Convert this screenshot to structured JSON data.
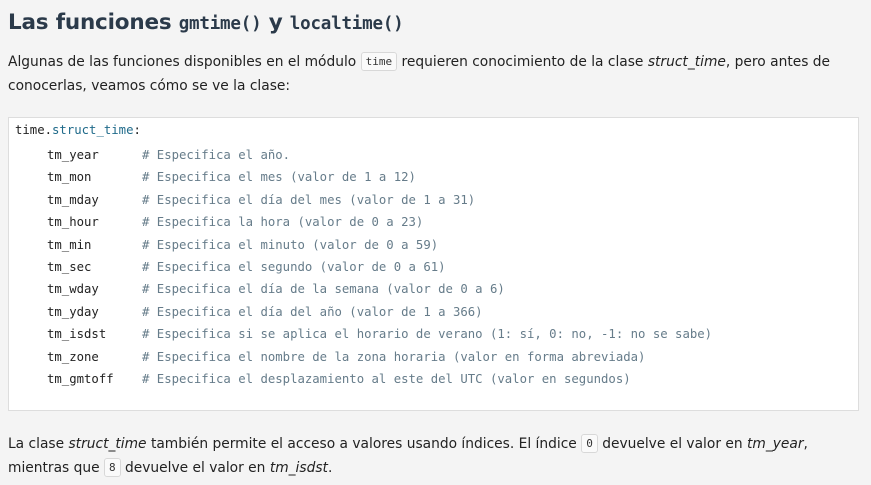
{
  "heading": {
    "prefix": "Las funciones ",
    "func1": "gmtime()",
    "conj": " y ",
    "func2": "localtime()"
  },
  "intro": {
    "text1": "Algunas de las funciones disponibles en el módulo ",
    "code": "time",
    "text2": " requieren conocimiento de la clase ",
    "em": "struct_time",
    "text3": ", pero antes de conocerlas, veamos cómo se ve la clase:"
  },
  "code": {
    "head_obj": "time.",
    "head_attr": "struct_time",
    "head_colon": ":",
    "rows": [
      {
        "field": "tm_year",
        "comment": "# Especifica el año."
      },
      {
        "field": "tm_mon",
        "comment": "# Especifica el mes (valor de 1 a 12)"
      },
      {
        "field": "tm_mday",
        "comment": "# Especifica el día del mes (valor de 1 a 31)"
      },
      {
        "field": "tm_hour",
        "comment": "# Especifica la hora (valor de 0 a 23)"
      },
      {
        "field": "tm_min",
        "comment": "# Especifica el minuto (valor de 0 a 59)"
      },
      {
        "field": "tm_sec",
        "comment": "# Especifica el segundo (valor de 0 a 61)"
      },
      {
        "field": "tm_wday",
        "comment": "# Especifica el día de la semana (valor de 0 a 6)"
      },
      {
        "field": "tm_yday",
        "comment": "# Especifica el día del año (valor de 1 a 366)"
      },
      {
        "field": "tm_isdst",
        "comment": "# Especifica si se aplica el horario de verano (1: sí, 0: no, -1: no se sabe)"
      },
      {
        "field": "tm_zone",
        "comment": "# Especifica el nombre de la zona horaria (valor en forma abreviada)"
      },
      {
        "field": "tm_gmtoff",
        "comment": "# Especifica el desplazamiento al este del UTC (valor en segundos)"
      }
    ]
  },
  "outro": {
    "text1": "La clase ",
    "em1": "struct_time",
    "text2": " también permite el acceso a valores usando índices. El índice ",
    "code1": "0",
    "text3": " devuelve el valor en ",
    "em2": "tm_year",
    "text4": ", mientras que ",
    "code2": "8",
    "text5": " devuelve el valor en ",
    "em3": "tm_isdst",
    "text6": "."
  }
}
